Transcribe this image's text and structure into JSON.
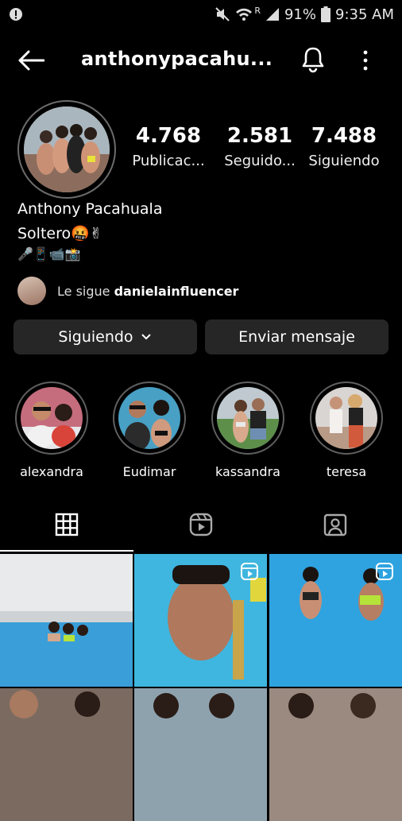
{
  "status_bar": {
    "battery": "91%",
    "time": "9:35 AM",
    "roaming": "R"
  },
  "header": {
    "username": "anthonypacahu..."
  },
  "stats": [
    {
      "value": "4.768",
      "label": "Publicac..."
    },
    {
      "value": "2.581",
      "label": "Seguido..."
    },
    {
      "value": "7.488",
      "label": "Siguiendo"
    }
  ],
  "profile": {
    "full_name": "Anthony Pacahuala",
    "bio_line1": "Soltero🤬✌",
    "bio_line2": "🎤📱📹📸",
    "followed_by_prefix": "Le sigue",
    "followed_by_user": "danielainfluencer"
  },
  "buttons": {
    "following": "Siguiendo",
    "message": "Enviar mensaje"
  },
  "highlights": [
    {
      "label": "alexandra"
    },
    {
      "label": "Eudimar"
    },
    {
      "label": "kassandra"
    },
    {
      "label": "teresa"
    }
  ],
  "tabs": [
    {
      "icon": "grid-icon",
      "active": true
    },
    {
      "icon": "reels-icon",
      "active": false
    },
    {
      "icon": "tagged-icon",
      "active": false
    }
  ],
  "grid_posts": [
    {
      "type": "photo"
    },
    {
      "type": "reel"
    },
    {
      "type": "reel"
    },
    {
      "type": "photo"
    },
    {
      "type": "photo"
    },
    {
      "type": "photo"
    }
  ]
}
